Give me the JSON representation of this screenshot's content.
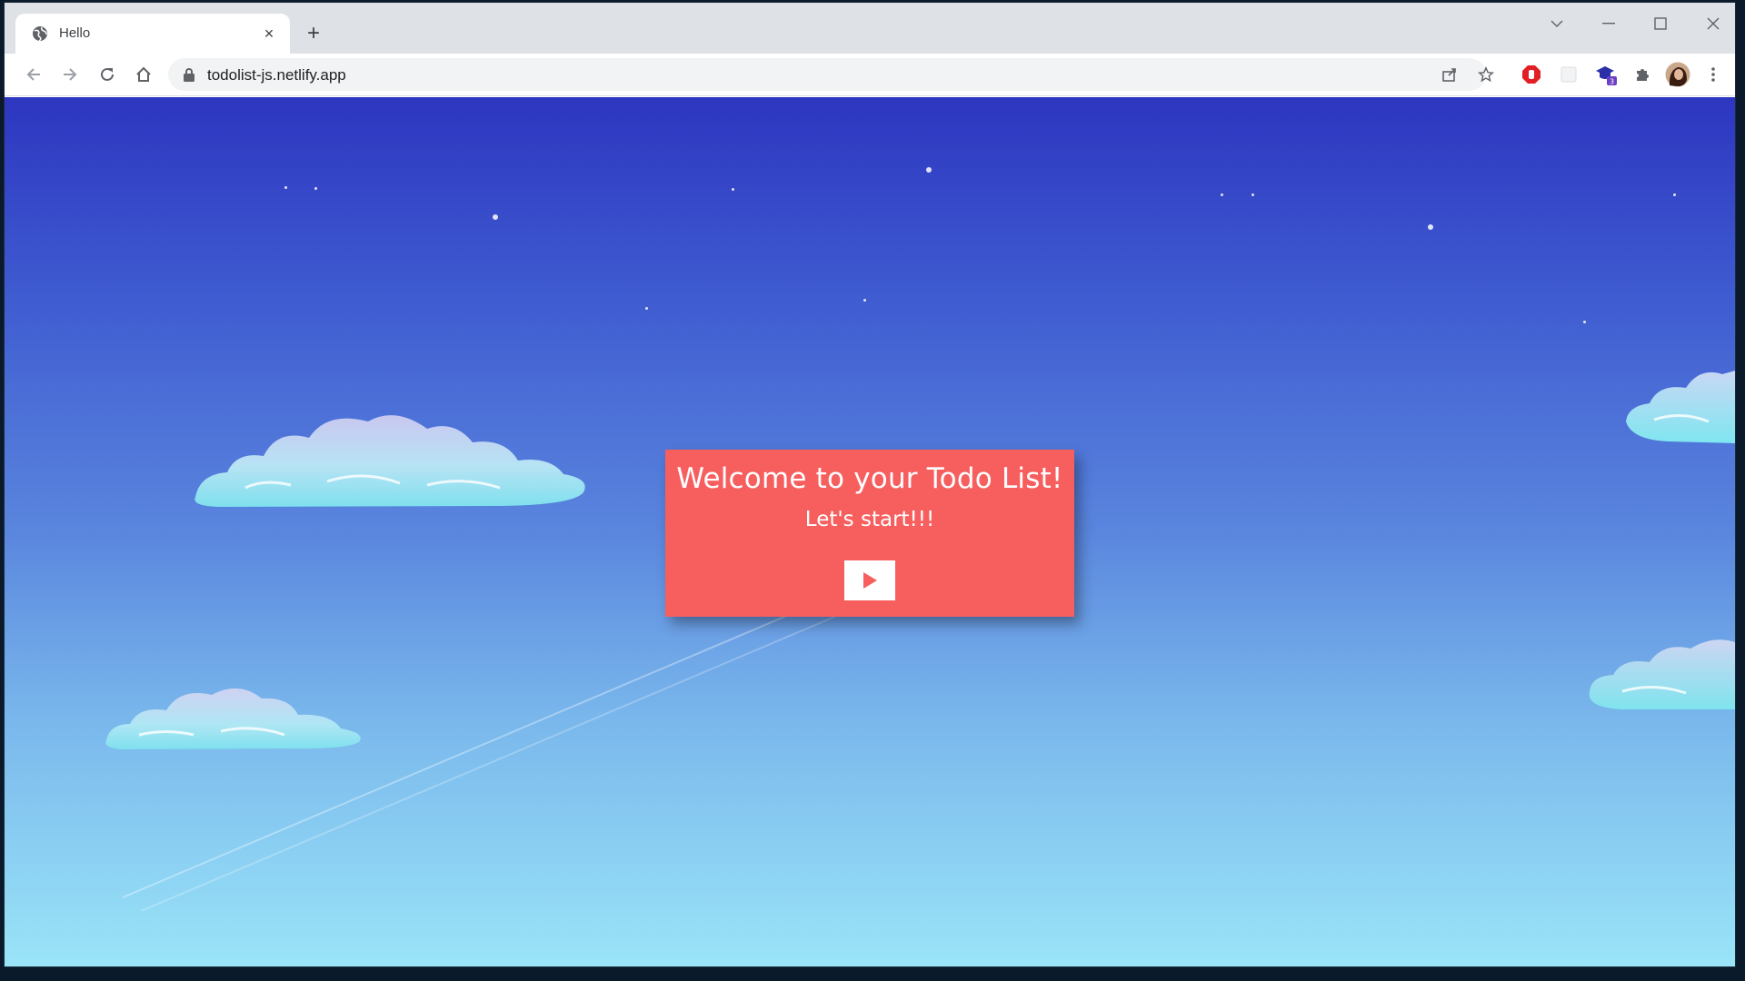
{
  "browser": {
    "tab_title": "Hello",
    "tab_close": "×",
    "new_tab": "+",
    "url": "todolist-js.netlify.app",
    "extension_badge": "3"
  },
  "page": {
    "heading": "Welcome to your Todo List!",
    "subheading": "Let's start!!!"
  },
  "colors": {
    "card": "#f75f5f",
    "sky_top": "#2d36c0",
    "sky_bottom": "#9ae4f8"
  }
}
